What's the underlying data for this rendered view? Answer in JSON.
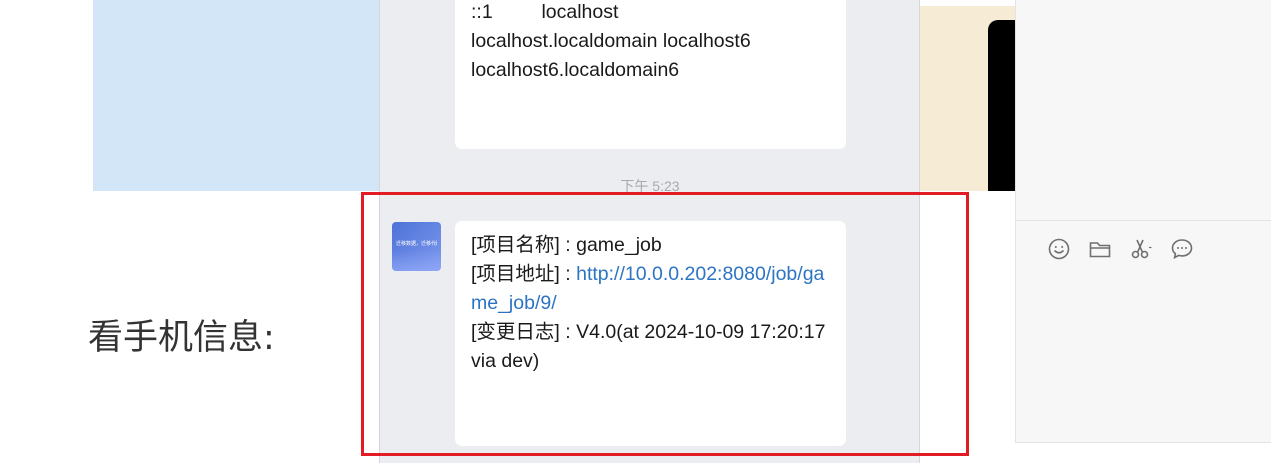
{
  "chat": {
    "messages": [
      {
        "lines": [
          "::1         localhost",
          "localhost.localdomain localhost6",
          "localhost6.localdomain6"
        ]
      },
      {
        "timestamp": "下午 5:23",
        "avatar": {
          "caption": "迁移数据，迁移代码。"
        },
        "project_name_label": "[项目名称] : ",
        "project_name": "game_job",
        "project_url_label": "[项目地址] : ",
        "project_url": "http://10.0.0.202:8080/job/game_job/9/",
        "changelog_label": "[变更日志] : ",
        "changelog": "V4.0(at 2024-10-09 17:20:17 via dev)"
      }
    ]
  },
  "page": {
    "heading": "看手机信息:"
  },
  "toolbar": {
    "icons": [
      "emoji-icon",
      "folder-icon",
      "scissors-icon",
      "chat-bubble-icon"
    ]
  },
  "colors": {
    "chat_background": "#ebedf0",
    "link": "#2c74c4",
    "highlight_frame": "#e11c25",
    "left_panel": "#d2e6f8",
    "side_strip": "#f6ecd6"
  }
}
